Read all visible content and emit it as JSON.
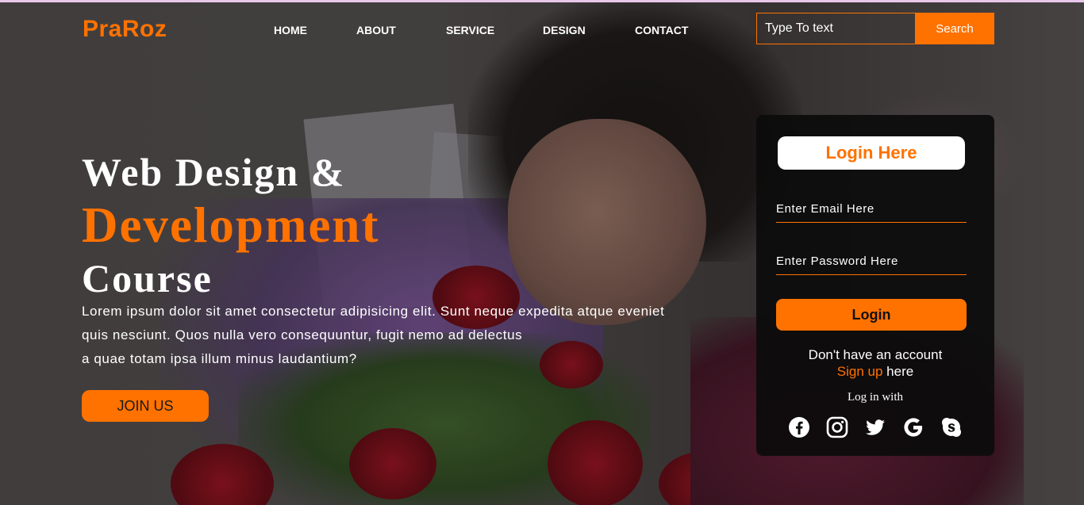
{
  "header": {
    "logo": "PraRoz",
    "nav": [
      "HOME",
      "ABOUT",
      "SERVICE",
      "DESIGN",
      "CONTACT"
    ],
    "search": {
      "placeholder": "Type To text",
      "button_label": "Search"
    }
  },
  "hero": {
    "line1": "Web Design &",
    "line2": "Development",
    "line3": "Course",
    "paragraph": [
      "Lorem ipsum dolor sit amet consectetur adipisicing elit. Sunt neque expedita atque eveniet",
      "quis nesciunt. Quos nulla vero consequuntur, fugit nemo ad delectus",
      "a quae totam ipsa illum minus laudantium?"
    ],
    "join_label": "JOIN US"
  },
  "login": {
    "title": "Login Here",
    "email_placeholder": "Enter Email Here",
    "password_placeholder": "Enter Password Here",
    "button_label": "Login",
    "no_account_text": "Don't have an account",
    "signup_link": "Sign up",
    "signup_suffix": " here",
    "login_with": "Log in with",
    "socials": [
      "facebook-icon",
      "instagram-icon",
      "twitter-icon",
      "google-icon",
      "skype-icon"
    ]
  },
  "colors": {
    "accent": "#ff7200",
    "card_bg": "#0c0c0c",
    "text": "#ffffff"
  }
}
